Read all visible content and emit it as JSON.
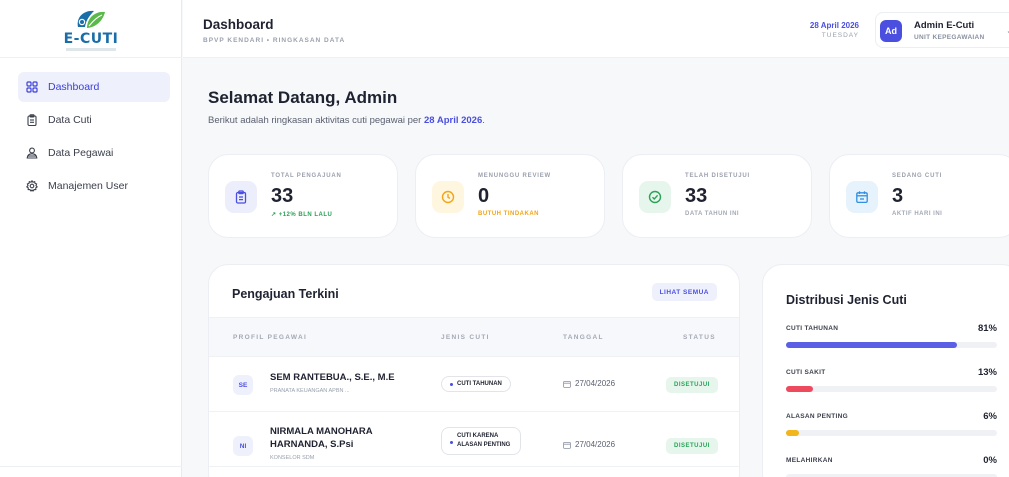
{
  "app": {
    "logo_text": "E-CUTI"
  },
  "sidebar": {
    "items": [
      {
        "label": "Dashboard",
        "icon": "grid-icon",
        "active": true
      },
      {
        "label": "Data Cuti",
        "icon": "clipboard-icon",
        "active": false
      },
      {
        "label": "Data Pegawai",
        "icon": "users-icon",
        "active": false
      },
      {
        "label": "Manajemen User",
        "icon": "gear-icon",
        "active": false
      }
    ]
  },
  "header": {
    "title": "Dashboard",
    "subtitle": "BPVP KENDARI • RINGKASAN DATA",
    "date": "28 April 2026",
    "day": "TUESDAY",
    "user": {
      "initials": "Ad",
      "name": "Admin E-Cuti",
      "role": "UNIT KEPEGAWAIAN"
    }
  },
  "welcome": {
    "title": "Selamat Datang, Admin",
    "subtitle_prefix": "Berikut adalah ringkasan aktivitas cuti pegawai per ",
    "subtitle_date": "28 April 2026",
    "subtitle_suffix": "."
  },
  "stats": [
    {
      "label": "TOTAL PENGAJUAN",
      "value": "33",
      "note": "↗ +12% BLN LALU",
      "icon": "clipboard-icon",
      "icon_bg": "#eceefc",
      "icon_color": "#4a4fe0",
      "note_color": "#2aa258"
    },
    {
      "label": "MENUNGGU REVIEW",
      "value": "0",
      "note": "BUTUH TINDAKAN",
      "icon": "clock-icon",
      "icon_bg": "#fff6e0",
      "icon_color": "#f2a516",
      "note_color": "#f2a516"
    },
    {
      "label": "TELAH DISETUJUI",
      "value": "33",
      "note": "DATA TAHUN INI",
      "icon": "check-circle-icon",
      "icon_bg": "#e6f6ec",
      "icon_color": "#2aa258",
      "note_color": "#a3a8b4"
    },
    {
      "label": "SEDANG CUTI",
      "value": "3",
      "note": "AKTIF HARI INI",
      "icon": "calendar-icon",
      "icon_bg": "#e6f2fc",
      "icon_color": "#2f8fe0",
      "note_color": "#a3a8b4"
    }
  ],
  "recent": {
    "title": "Pengajuan Terkini",
    "see_all": "LIHAT SEMUA",
    "columns": [
      "PROFIL PEGAWAI",
      "JENIS CUTI",
      "TANGGAL",
      "STATUS"
    ],
    "rows": [
      {
        "initials": "SE",
        "name": "SEM RANTEBUA., S.E., M.E",
        "role": "PRANATA KEUANGAN APBN ...",
        "leave_type": "CUTI TAHUNAN",
        "date": "27/04/2026",
        "status": "DISETUJUI"
      },
      {
        "initials": "NI",
        "name": "NIRMALA MANOHARA HARNANDA, S.Psi",
        "role": "KONSELOR SDM",
        "leave_type": "CUTI KARENA ALASAN PENTING",
        "date": "27/04/2026",
        "status": "DISETUJUI"
      }
    ]
  },
  "distribution": {
    "title": "Distribusi Jenis Cuti",
    "items": [
      {
        "label": "CUTI TAHUNAN",
        "percent_text": "81%",
        "percent": 81,
        "color": "#5b5fe6"
      },
      {
        "label": "CUTI SAKIT",
        "percent_text": "13%",
        "percent": 13,
        "color": "#ee4a5e"
      },
      {
        "label": "ALASAN PENTING",
        "percent_text": "6%",
        "percent": 6,
        "color": "#f2b51c"
      },
      {
        "label": "MELAHIRKAN",
        "percent_text": "0%",
        "percent": 0,
        "color": "#2aa258"
      }
    ]
  }
}
